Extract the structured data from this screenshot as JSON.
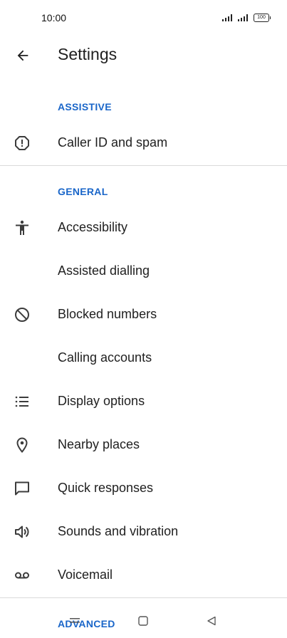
{
  "status_bar": {
    "time": "10:00",
    "battery": "100",
    "icons": [
      "signal-icon",
      "signal-icon",
      "battery-icon"
    ]
  },
  "app_bar": {
    "title": "Settings",
    "back_icon": "arrow-back-icon"
  },
  "sections": {
    "assistive": "ASSISTIVE",
    "general": "GENERAL",
    "advanced": "ADVANCED"
  },
  "items": [
    {
      "label": "Caller ID and spam",
      "icon": "alert-circle-icon"
    },
    {
      "label": "Accessibility",
      "icon": "accessibility-icon"
    },
    {
      "label": "Assisted dialling",
      "icon": ""
    },
    {
      "label": "Blocked numbers",
      "icon": "block-icon"
    },
    {
      "label": "Calling accounts",
      "icon": ""
    },
    {
      "label": "Display options",
      "icon": "list-icon"
    },
    {
      "label": "Nearby places",
      "icon": "location-pin-icon"
    },
    {
      "label": "Quick responses",
      "icon": "message-icon"
    },
    {
      "label": "Sounds and vibration",
      "icon": "volume-icon"
    },
    {
      "label": "Voicemail",
      "icon": "voicemail-icon"
    }
  ],
  "nav_bar": {
    "icons": [
      "menu-icon",
      "home-square-icon",
      "back-triangle-icon"
    ]
  },
  "colors": {
    "accent": "#1a66c9",
    "text": "#1f1f1f",
    "icon": "#3c3c3c",
    "divider": "#dadada",
    "background": "#ffffff"
  }
}
